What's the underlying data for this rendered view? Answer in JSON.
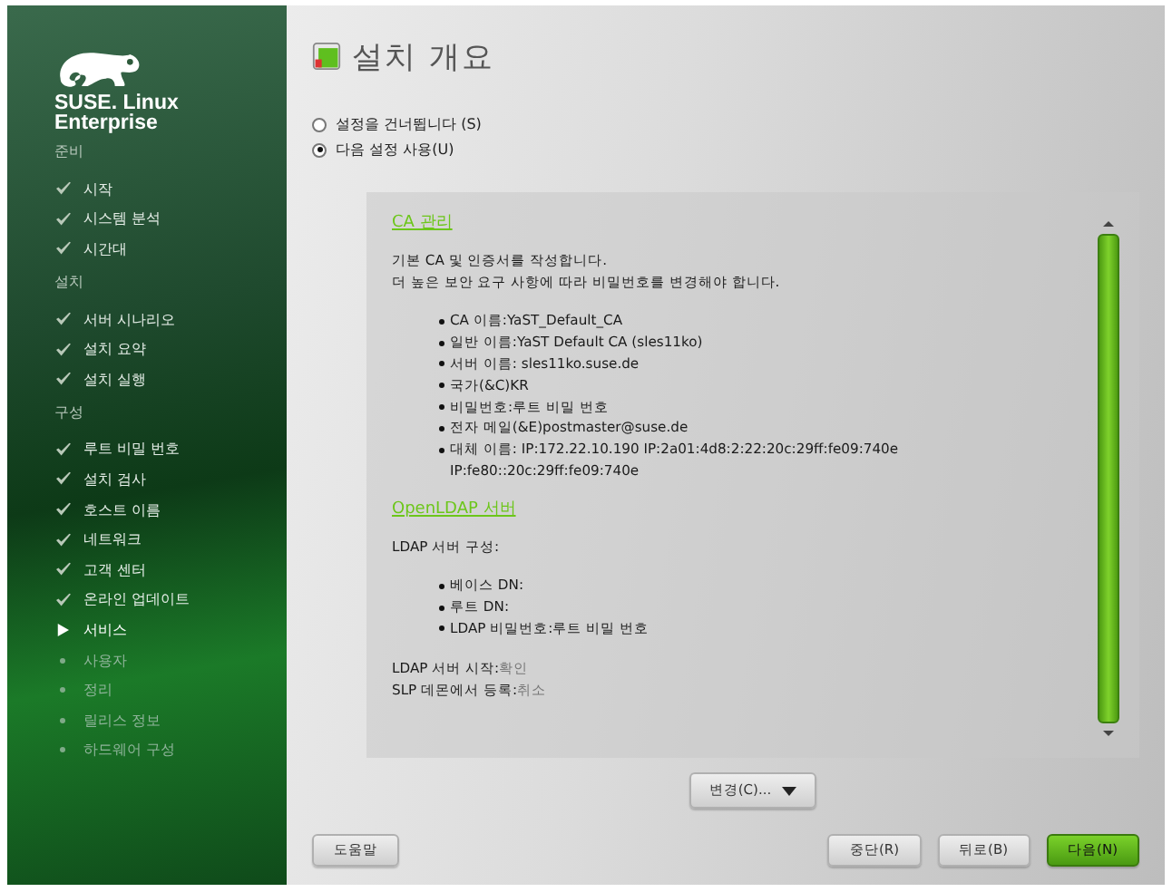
{
  "sidebar": {
    "brand": "SUSE. Linux Enterprise",
    "sections": [
      {
        "title": "준비",
        "items": [
          {
            "label": "시작",
            "kind": "done"
          },
          {
            "label": "시스템 분석",
            "kind": "done"
          },
          {
            "label": "시간대",
            "kind": "done"
          }
        ]
      },
      {
        "title": "설치",
        "items": [
          {
            "label": "서버 시나리오",
            "kind": "done"
          },
          {
            "label": "설치 요약",
            "kind": "done"
          },
          {
            "label": "설치 실행",
            "kind": "done"
          }
        ]
      },
      {
        "title": "구성",
        "items": [
          {
            "label": "루트 비밀 번호",
            "kind": "done"
          },
          {
            "label": "설치 검사",
            "kind": "done"
          },
          {
            "label": "호스트 이름",
            "kind": "done"
          },
          {
            "label": "네트워크",
            "kind": "done"
          },
          {
            "label": "고객 센터",
            "kind": "done"
          },
          {
            "label": "온라인 업데이트",
            "kind": "done"
          },
          {
            "label": "서비스",
            "kind": "current"
          },
          {
            "label": "사용자",
            "kind": "pending"
          },
          {
            "label": "정리",
            "kind": "pending"
          },
          {
            "label": "릴리스 정보",
            "kind": "pending"
          },
          {
            "label": "하드웨어 구성",
            "kind": "pending"
          }
        ]
      }
    ]
  },
  "page_title": "설치 개요",
  "options": [
    {
      "label": "설정을 건너뜁니다 (S)",
      "selected": false
    },
    {
      "label": "다음 설정 사용(U)",
      "selected": true
    }
  ],
  "summary": {
    "sections": [
      {
        "heading": "CA 관리",
        "paragraphs": [
          "기본 CA 및 인증서를 작성합니다.",
          "더 높은 보안 요구 사항에 따라 비밀번호를 변경해야 합니다."
        ],
        "bullets": [
          "CA 이름:YaST_Default_CA",
          "일반 이름:YaST Default CA (sles11ko)",
          "서버 이름: sles11ko.suse.de",
          "국가(&C)KR",
          "비밀번호:루트 비밀 번호",
          "전자 메일(&E)postmaster@suse.de",
          "대체 이름: IP:172.22.10.190 IP:2a01:4d8:2:22:20c:29ff:fe09:740e IP:fe80::20c:29ff:fe09:740e"
        ]
      },
      {
        "heading": "OpenLDAP 서버",
        "paragraphs": [
          "LDAP 서버 구성:"
        ],
        "bullets": [
          "베이스 DN:",
          "루트 DN:",
          "LDAP 비밀번호:루트 비밀 번호"
        ],
        "settings": [
          {
            "label": "LDAP 서버 시작:",
            "value": "확인"
          },
          {
            "label": "SLP 데몬에서 등록:",
            "value": "취소"
          }
        ]
      }
    ]
  },
  "change_button": "변경(C)...",
  "buttons": [
    {
      "label": "도움말",
      "kind": "normal"
    },
    {
      "label": "중단(R)",
      "kind": "normal"
    },
    {
      "label": "뒤로(B)",
      "kind": "normal"
    },
    {
      "label": "다음(N)",
      "kind": "primary"
    }
  ]
}
